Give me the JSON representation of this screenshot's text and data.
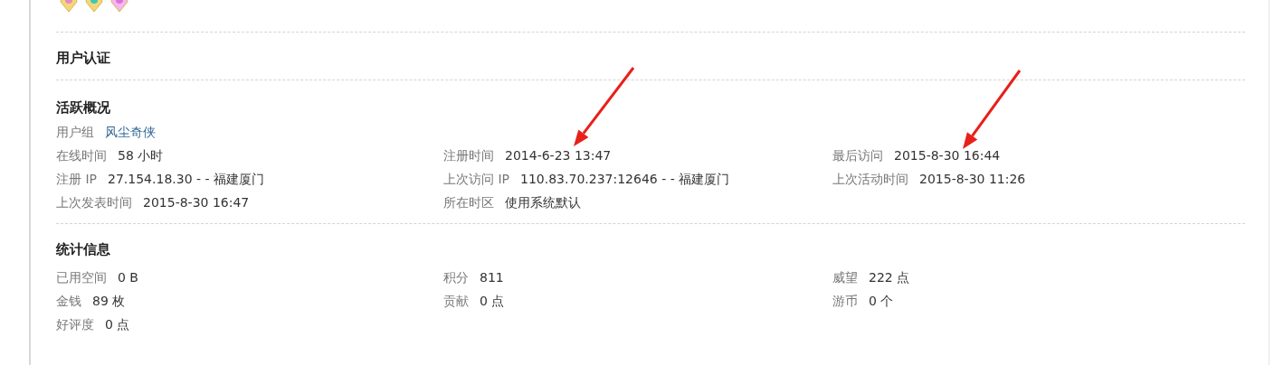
{
  "medals": [
    {
      "kind": "gold-pink"
    },
    {
      "kind": "gold-teal"
    },
    {
      "kind": "pink-heart"
    }
  ],
  "verification": {
    "title": "用户认证"
  },
  "activity": {
    "title": "活跃概况",
    "user_group": {
      "label": "用户组",
      "value": "风尘奇侠"
    },
    "columns": [
      [
        {
          "label": "在线时间",
          "value": "58 小时"
        },
        {
          "label": "注册 IP",
          "value": "27.154.18.30 - - 福建厦门"
        },
        {
          "label": "上次发表时间",
          "value": "2015-8-30 16:47"
        }
      ],
      [
        {
          "label": "注册时间",
          "value": "2014-6-23 13:47"
        },
        {
          "label": "上次访问 IP",
          "value": "110.83.70.237:12646 - - 福建厦门"
        },
        {
          "label": "所在时区",
          "value": "使用系统默认"
        }
      ],
      [
        {
          "label": "最后访问",
          "value": "2015-8-30 16:44"
        },
        {
          "label": "上次活动时间",
          "value": "2015-8-30 11:26"
        }
      ]
    ]
  },
  "statistics": {
    "title": "统计信息",
    "columns": [
      [
        {
          "label": "已用空间",
          "value": "0 B"
        },
        {
          "label": "金钱",
          "value": "89 枚"
        },
        {
          "label": "好评度",
          "value": "0 点"
        }
      ],
      [
        {
          "label": "积分",
          "value": "811"
        },
        {
          "label": "贡献",
          "value": "0 点"
        }
      ],
      [
        {
          "label": "威望",
          "value": "222 点"
        },
        {
          "label": "游币",
          "value": "0 个"
        }
      ]
    ]
  }
}
